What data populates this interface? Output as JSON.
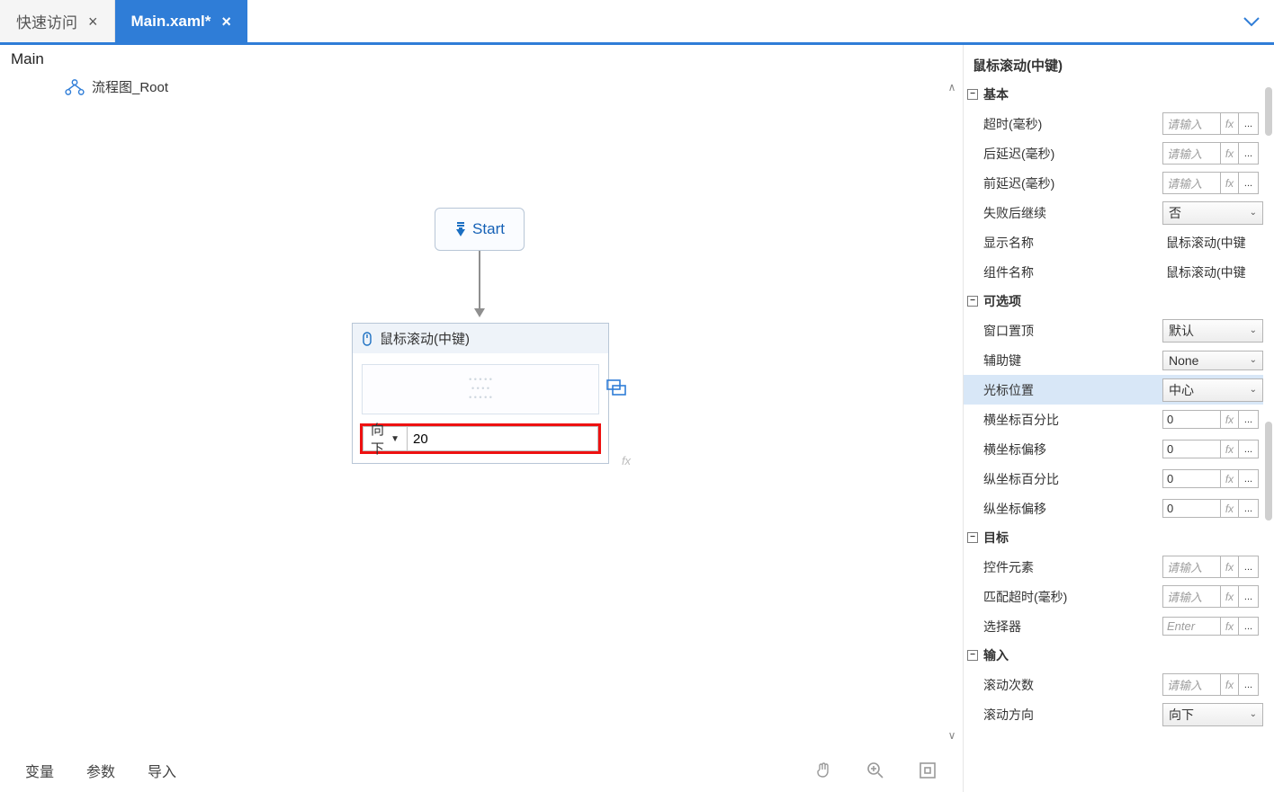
{
  "tabs": {
    "quick_access": "快速访问",
    "main": "Main.xaml*"
  },
  "breadcrumb": "Main",
  "flowchart": {
    "root_label": "流程图_Root"
  },
  "start": {
    "label": "Start"
  },
  "activity": {
    "title": "鼠标滚动(中键)",
    "direction": "向下",
    "count": "20"
  },
  "bottom": {
    "variables": "变量",
    "params": "参数",
    "import": "导入"
  },
  "props": {
    "title": "鼠标滚动(中键)",
    "placeholder_input": "请输入",
    "placeholder_enter": "Enter ",
    "fx": "fx",
    "more": "...",
    "sections": {
      "basic": "基本",
      "optional": "可选项",
      "target": "目标",
      "input": "输入"
    },
    "basic": {
      "timeout": "超时(毫秒)",
      "post_delay": "后延迟(毫秒)",
      "pre_delay": "前延迟(毫秒)",
      "continue_on_fail": "失败后继续",
      "continue_on_fail_val": "否",
      "display_name": "显示名称",
      "display_name_val": "鼠标滚动(中键",
      "component_name": "组件名称",
      "component_name_val": "鼠标滚动(中键"
    },
    "optional": {
      "topmost": "窗口置顶",
      "topmost_val": "默认",
      "modifier": "辅助键",
      "modifier_val": "None",
      "cursor_pos": "光标位置",
      "cursor_pos_val": "中心",
      "x_percent": "横坐标百分比",
      "x_percent_val": "0",
      "x_offset": "横坐标偏移",
      "x_offset_val": "0",
      "y_percent": "纵坐标百分比",
      "y_percent_val": "0",
      "y_offset": "纵坐标偏移",
      "y_offset_val": "0"
    },
    "target": {
      "element": "控件元素",
      "match_timeout": "匹配超时(毫秒)",
      "selector": "选择器"
    },
    "input": {
      "scroll_count": "滚动次数",
      "scroll_dir": "滚动方向",
      "scroll_dir_val": "向下"
    }
  }
}
